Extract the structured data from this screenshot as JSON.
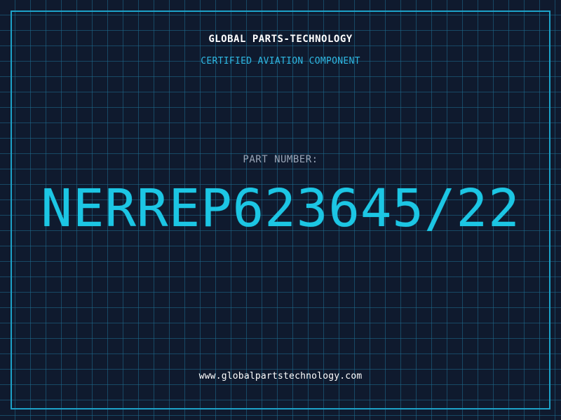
{
  "header": {
    "company": "GLOBAL PARTS-TECHNOLOGY",
    "tagline": "CERTIFIED AVIATION COMPONENT"
  },
  "part": {
    "label": "PART NUMBER:",
    "number": "NERREP623645/22"
  },
  "footer": {
    "website": "www.globalpartstechnology.com"
  },
  "colors": {
    "background": "#0f1a2e",
    "grid": "#1e6e91",
    "frame": "#1da2c8",
    "accent": "#1cc6e4",
    "tagline": "#2fb8e3",
    "label": "#9aa6b8",
    "text": "#ffffff"
  }
}
